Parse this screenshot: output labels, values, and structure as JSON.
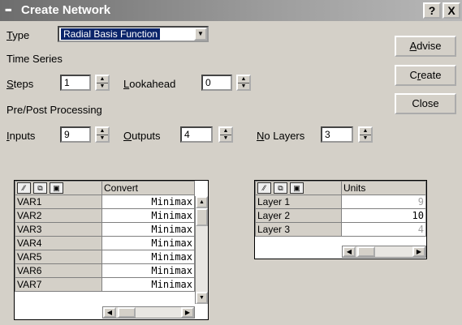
{
  "window": {
    "title": "Create Network",
    "help_label": "?",
    "close_label": "X"
  },
  "type": {
    "label_u": "T",
    "label_rest": "ype",
    "value": "Radial Basis Function"
  },
  "time_series": {
    "heading": "Time Series",
    "steps_u": "S",
    "steps_rest": "teps",
    "steps_value": "1",
    "lookahead_u": "L",
    "lookahead_rest": "ookahead",
    "lookahead_value": "0"
  },
  "prepost": {
    "heading": "Pre/Post Processing",
    "inputs_u": "I",
    "inputs_rest": "nputs",
    "inputs_value": "9",
    "outputs_u": "O",
    "outputs_rest": "utputs",
    "outputs_value": "4",
    "layers_u": "N",
    "layers_rest": "o Layers",
    "layers_value": "3"
  },
  "buttons": {
    "advise_u": "A",
    "advise_rest": "dvise",
    "create_pre": "C",
    "create_u": "r",
    "create_rest": "eate",
    "close_label": "Close"
  },
  "variables_grid": {
    "header": "Convert",
    "rows": [
      {
        "name": "VAR1",
        "value": "Minimax"
      },
      {
        "name": "VAR2",
        "value": "Minimax"
      },
      {
        "name": "VAR3",
        "value": "Minimax"
      },
      {
        "name": "VAR4",
        "value": "Minimax"
      },
      {
        "name": "VAR5",
        "value": "Minimax"
      },
      {
        "name": "VAR6",
        "value": "Minimax"
      },
      {
        "name": "VAR7",
        "value": "Minimax"
      }
    ]
  },
  "layers_grid": {
    "header": "Units",
    "rows": [
      {
        "name": "Layer 1",
        "value": "9"
      },
      {
        "name": "Layer 2",
        "value": "10"
      },
      {
        "name": "Layer 3",
        "value": "4"
      }
    ]
  }
}
